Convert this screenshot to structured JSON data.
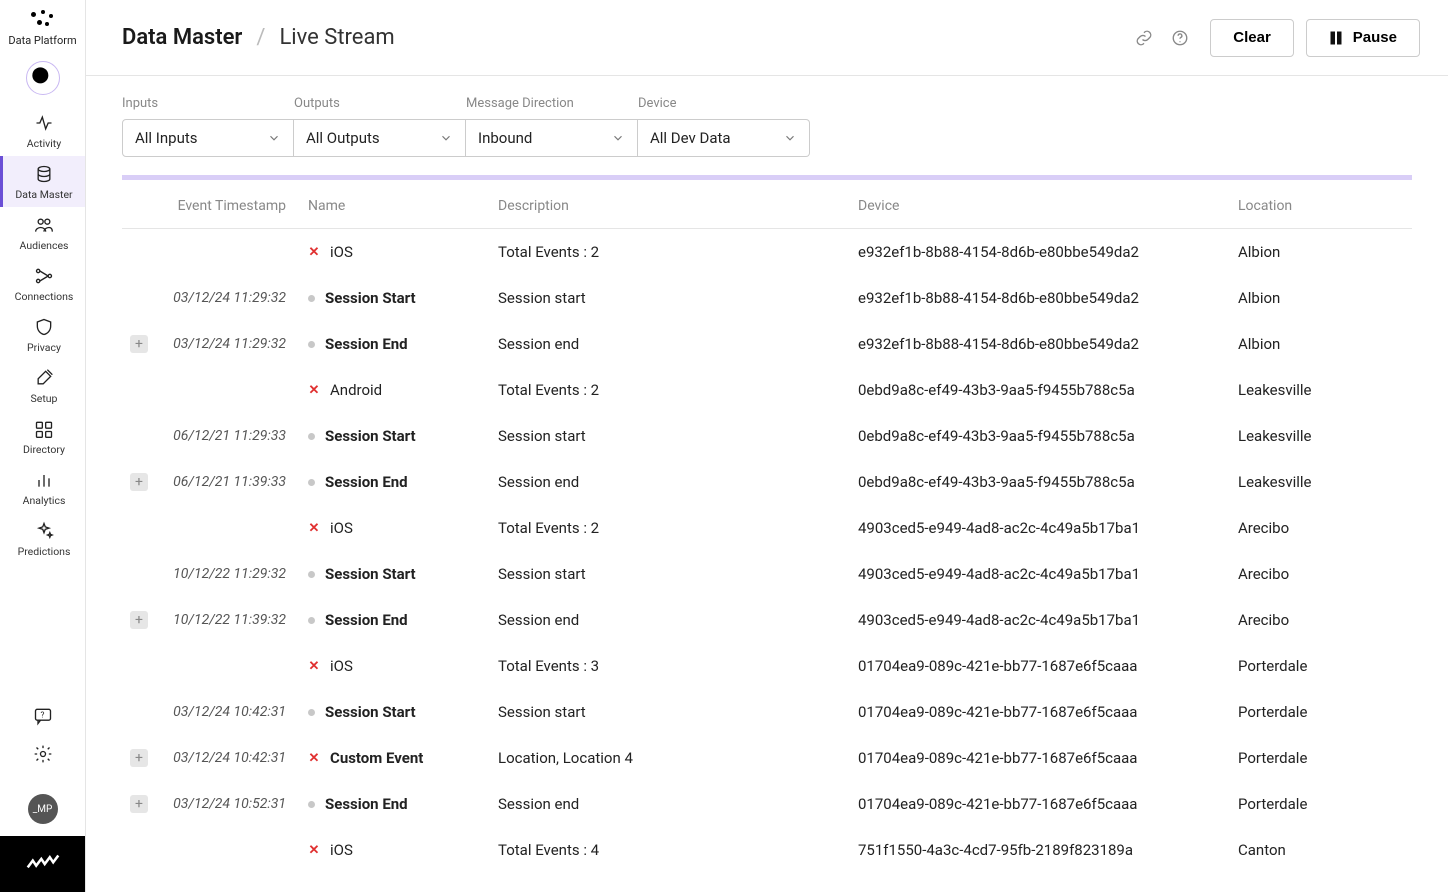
{
  "brand": "Data Platform",
  "avatar": "_MP",
  "sidebar": [
    {
      "id": "activity",
      "label": "Activity"
    },
    {
      "id": "data-master",
      "label": "Data Master"
    },
    {
      "id": "audiences",
      "label": "Audiences"
    },
    {
      "id": "connections",
      "label": "Connections"
    },
    {
      "id": "privacy",
      "label": "Privacy"
    },
    {
      "id": "setup",
      "label": "Setup"
    },
    {
      "id": "directory",
      "label": "Directory"
    },
    {
      "id": "analytics",
      "label": "Analytics"
    },
    {
      "id": "predictions",
      "label": "Predictions"
    }
  ],
  "breadcrumb": {
    "root": "Data Master",
    "leaf": "Live Stream"
  },
  "actions": {
    "clear": "Clear",
    "pause": "Pause"
  },
  "filters": {
    "inputs": {
      "label": "Inputs",
      "value": "All Inputs"
    },
    "outputs": {
      "label": "Outputs",
      "value": "All Outputs"
    },
    "direction": {
      "label": "Message Direction",
      "value": "Inbound"
    },
    "device": {
      "label": "Device",
      "value": "All Dev Data"
    }
  },
  "columns": {
    "timestamp": "Event Timestamp",
    "name": "Name",
    "description": "Description",
    "device": "Device",
    "location": "Location"
  },
  "rows": [
    {
      "expand": false,
      "ts": "",
      "ind": "x",
      "name": "iOS",
      "bold": false,
      "desc": "Total Events : 2",
      "dev": "e932ef1b-8b88-4154-8d6b-e80bbe549da2",
      "loc": "Albion"
    },
    {
      "expand": false,
      "ts": "03/12/24 11:29:32",
      "ind": "dot",
      "name": "Session Start",
      "bold": true,
      "desc": "Session start",
      "dev": "e932ef1b-8b88-4154-8d6b-e80bbe549da2",
      "loc": "Albion"
    },
    {
      "expand": true,
      "ts": "03/12/24 11:29:32",
      "ind": "dot",
      "name": "Session End",
      "bold": true,
      "desc": "Session end",
      "dev": "e932ef1b-8b88-4154-8d6b-e80bbe549da2",
      "loc": "Albion"
    },
    {
      "expand": false,
      "ts": "",
      "ind": "x",
      "name": "Android",
      "bold": false,
      "desc": "Total Events : 2",
      "dev": "0ebd9a8c-ef49-43b3-9aa5-f9455b788c5a",
      "loc": "Leakesville"
    },
    {
      "expand": false,
      "ts": "06/12/21 11:29:33",
      "ind": "dot",
      "name": "Session Start",
      "bold": true,
      "desc": "Session start",
      "dev": "0ebd9a8c-ef49-43b3-9aa5-f9455b788c5a",
      "loc": "Leakesville"
    },
    {
      "expand": true,
      "ts": "06/12/21 11:39:33",
      "ind": "dot",
      "name": "Session End",
      "bold": true,
      "desc": "Session end",
      "dev": "0ebd9a8c-ef49-43b3-9aa5-f9455b788c5a",
      "loc": "Leakesville"
    },
    {
      "expand": false,
      "ts": "",
      "ind": "x",
      "name": "iOS",
      "bold": false,
      "desc": "Total Events : 2",
      "dev": "4903ced5-e949-4ad8-ac2c-4c49a5b17ba1",
      "loc": "Arecibo"
    },
    {
      "expand": false,
      "ts": "10/12/22 11:29:32",
      "ind": "dot",
      "name": "Session Start",
      "bold": true,
      "desc": "Session start",
      "dev": "4903ced5-e949-4ad8-ac2c-4c49a5b17ba1",
      "loc": "Arecibo"
    },
    {
      "expand": true,
      "ts": "10/12/22 11:39:32",
      "ind": "dot",
      "name": "Session End",
      "bold": true,
      "desc": "Session end",
      "dev": "4903ced5-e949-4ad8-ac2c-4c49a5b17ba1",
      "loc": "Arecibo"
    },
    {
      "expand": false,
      "ts": "",
      "ind": "x",
      "name": "iOS",
      "bold": false,
      "desc": "Total Events : 3",
      "dev": "01704ea9-089c-421e-bb77-1687e6f5caaa",
      "loc": "Porterdale"
    },
    {
      "expand": false,
      "ts": "03/12/24 10:42:31",
      "ind": "dot",
      "name": "Session Start",
      "bold": true,
      "desc": "Session start",
      "dev": "01704ea9-089c-421e-bb77-1687e6f5caaa",
      "loc": "Porterdale"
    },
    {
      "expand": true,
      "ts": "03/12/24 10:42:31",
      "ind": "x",
      "name": "Custom Event",
      "bold": true,
      "desc": "Location, Location 4",
      "dev": "01704ea9-089c-421e-bb77-1687e6f5caaa",
      "loc": "Porterdale"
    },
    {
      "expand": true,
      "ts": "03/12/24 10:52:31",
      "ind": "dot",
      "name": "Session End",
      "bold": true,
      "desc": "Session end",
      "dev": "01704ea9-089c-421e-bb77-1687e6f5caaa",
      "loc": "Porterdale"
    },
    {
      "expand": false,
      "ts": "",
      "ind": "x",
      "name": "iOS",
      "bold": false,
      "desc": "Total Events : 4",
      "dev": "751f1550-4a3c-4cd7-95fb-2189f823189a",
      "loc": "Canton"
    }
  ]
}
